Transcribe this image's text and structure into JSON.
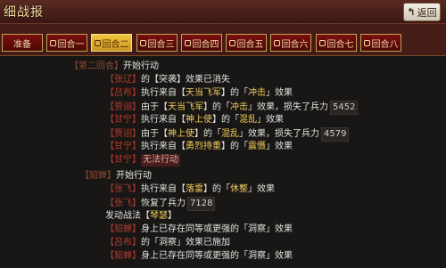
{
  "window": {
    "title": "细战报",
    "back_label": "返回"
  },
  "tabs": [
    {
      "label": "准备",
      "active": false,
      "icon": false
    },
    {
      "label": "回合一",
      "active": false,
      "icon": true
    },
    {
      "label": "回合二",
      "active": true,
      "icon": true
    },
    {
      "label": "回合三",
      "active": false,
      "icon": true
    },
    {
      "label": "回合四",
      "active": false,
      "icon": true
    },
    {
      "label": "回合五",
      "active": false,
      "icon": true
    },
    {
      "label": "回合六",
      "active": false,
      "icon": true
    },
    {
      "label": "回合七",
      "active": false,
      "icon": true
    },
    {
      "label": "回合八",
      "active": false,
      "icon": true
    }
  ],
  "report": {
    "round1_tag": "【第二回合】",
    "round1_start": "开始行动",
    "l1": {
      "actor": "【张辽】",
      "text": "的【突袭】效果已消失"
    },
    "l2": {
      "actor": "【吕布】",
      "pre": "执行来自【",
      "skill": "天当飞军",
      "mid": "】的「",
      "status": "冲击",
      "post": "」效果"
    },
    "l3": {
      "actor": "【贾诩】",
      "pre": "由于【",
      "skill": "天当飞军",
      "mid": "】的「",
      "status": "冲击",
      "post": "」效果，损失了兵力",
      "val": "5452"
    },
    "l4": {
      "actor": "【甘宁】",
      "pre": "执行来自【",
      "skill": "神上使",
      "mid": "】的「",
      "status": "混乱",
      "post": "」效果"
    },
    "l5": {
      "actor": "【贾诩】",
      "pre": "由于【",
      "skill": "神上使",
      "mid": "】的「",
      "status": "混乱",
      "post": "」效果，损失了兵力",
      "val": "4579"
    },
    "l6": {
      "actor": "【甘宁】",
      "pre": "执行来自【",
      "skill": "勇烈持重",
      "mid": "】的「",
      "status": "震慑",
      "post": "」效果"
    },
    "l7": {
      "actor": "【甘宁】",
      "text": "无法行动"
    },
    "round2_tag": "【貂蝉】",
    "round2_start": "开始行动",
    "l8": {
      "actor": "【张飞】",
      "pre": "执行来自【",
      "skill": "落雷",
      "mid": "】的「",
      "status": "休整",
      "post": "」效果"
    },
    "l9": {
      "actor": "【张飞】",
      "text": "恢复了兵力",
      "val": "7128"
    },
    "l10": {
      "pre": "发动战法【",
      "skill": "琴瑟",
      "post": "】"
    },
    "l11": {
      "actor": "【貂蝉】",
      "text": "身上已存在同等或更强的「洞察」效果"
    },
    "l12": {
      "actor": "【吕布】",
      "text": "的「洞察」效果已施加"
    },
    "l13": {
      "actor": "【貂蝉】",
      "text": "身上已存在同等或更强的「洞察」效果"
    }
  }
}
